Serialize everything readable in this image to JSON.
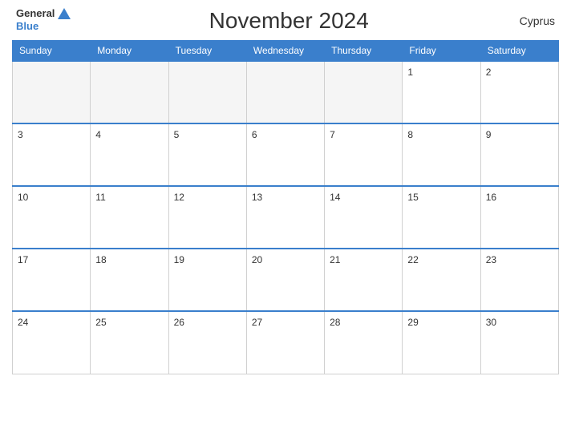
{
  "header": {
    "logo_line1": "General",
    "logo_line2": "Blue",
    "title": "November 2024",
    "country": "Cyprus"
  },
  "days_of_week": [
    "Sunday",
    "Monday",
    "Tuesday",
    "Wednesday",
    "Thursday",
    "Friday",
    "Saturday"
  ],
  "weeks": [
    [
      null,
      null,
      null,
      null,
      null,
      1,
      2
    ],
    [
      3,
      4,
      5,
      6,
      7,
      8,
      9
    ],
    [
      10,
      11,
      12,
      13,
      14,
      15,
      16
    ],
    [
      17,
      18,
      19,
      20,
      21,
      22,
      23
    ],
    [
      24,
      25,
      26,
      27,
      28,
      29,
      30
    ]
  ],
  "colors": {
    "header_bg": "#3a7fcc",
    "header_text": "#ffffff",
    "cell_border_top": "#3a7fcc",
    "body_text": "#333333",
    "empty_cell_bg": "#f5f5f5"
  }
}
